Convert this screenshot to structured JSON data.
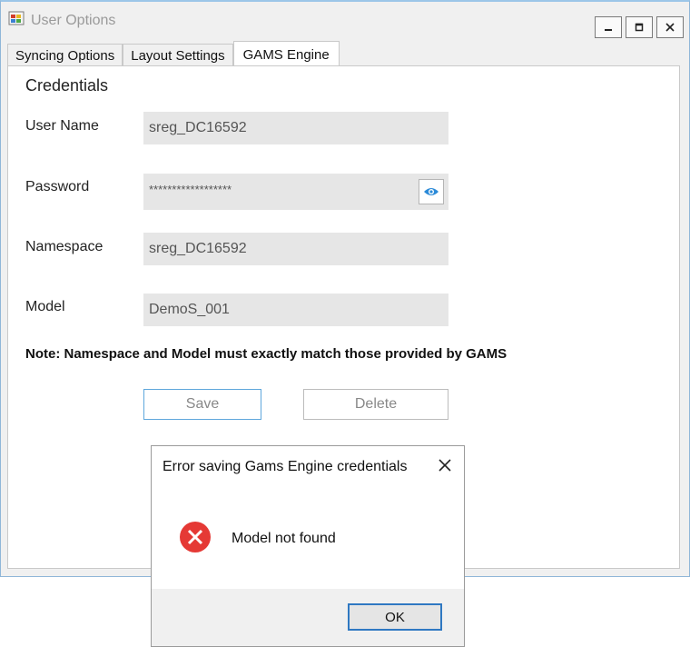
{
  "window": {
    "title": "User Options",
    "icon": "app-window-icon",
    "controls": {
      "minimize": "—",
      "maximize": "▫",
      "close": "✕"
    }
  },
  "tabs": [
    {
      "label": "Syncing Options",
      "active": false
    },
    {
      "label": "Layout Settings",
      "active": false
    },
    {
      "label": "GAMS Engine",
      "active": true
    }
  ],
  "credentials": {
    "group_title": "Credentials",
    "username_label": "User Name",
    "username_value": "sreg_DC16592",
    "password_label": "Password",
    "password_value": "******************",
    "show_password_icon": "eye-icon",
    "namespace_label": "Namespace",
    "namespace_value": "sreg_DC16592",
    "model_label": "Model",
    "model_value": "DemoS_001",
    "note": "Note: Namespace and Model must exactly match those provided by GAMS",
    "save_label": "Save",
    "delete_label": "Delete"
  },
  "dialog": {
    "title": "Error saving Gams Engine credentials",
    "message": "Model not found",
    "ok_label": "OK",
    "icon": "error-icon"
  },
  "colors": {
    "accent": "#56a8e0",
    "error": "#e53935",
    "focus_border": "#2f78c2"
  }
}
